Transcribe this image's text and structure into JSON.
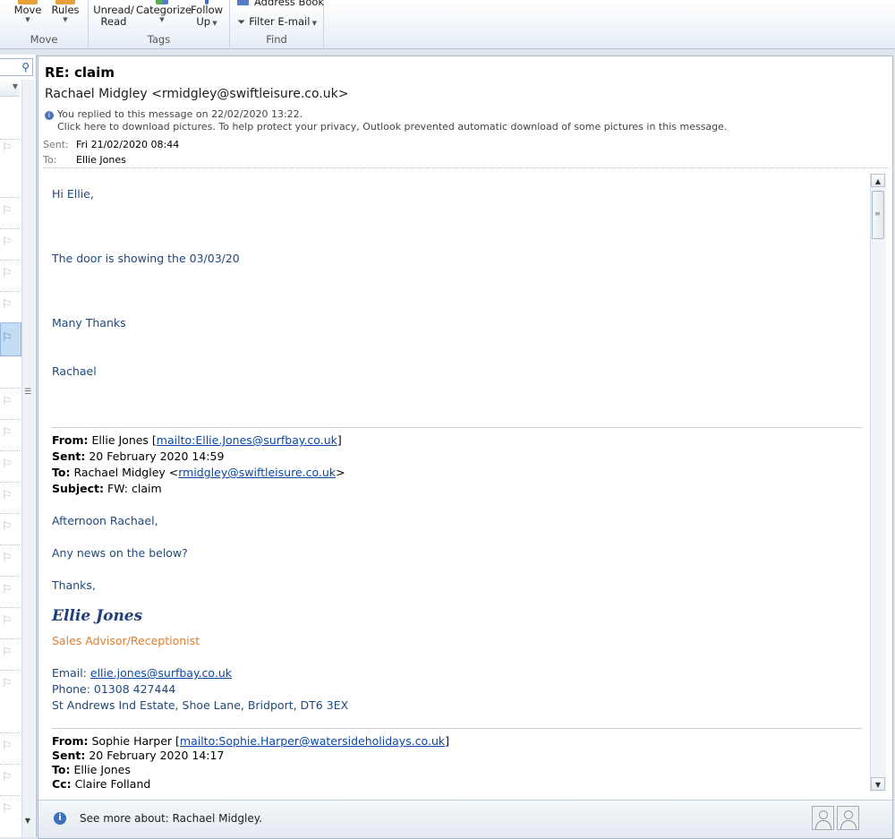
{
  "ribbon": {
    "move_group": {
      "label": "Move",
      "move": "Move",
      "rules": "Rules"
    },
    "tags_group": {
      "label": "Tags",
      "unread_line1": "Unread/",
      "unread_line2": "Read",
      "categorize": "Categorize",
      "followup_line1": "Follow",
      "followup_line2": "Up"
    },
    "find_group": {
      "label": "Find",
      "address_book": "Address Book",
      "filter_email": "Filter E-mail"
    }
  },
  "message": {
    "subject": "RE: claim",
    "sender": "Rachael Midgley <rmidgley@swiftleisure.co.uk>",
    "info_replied": "You replied to this message on 22/02/2020 13:22.",
    "info_pictures": "Click here to download pictures. To help protect your privacy, Outlook prevented automatic download of some pictures in this message.",
    "sent_label": "Sent:",
    "sent_value": "Fri 21/02/2020 08:44",
    "to_label": "To:",
    "to_value": "Ellie Jones"
  },
  "body": {
    "greeting": "Hi Ellie,",
    "line1": "The door is showing the 03/03/20",
    "thanks": "Many Thanks",
    "signoff": "Rachael",
    "quote1": {
      "from_label": "From:",
      "from_name": "Ellie Jones [",
      "from_link": "mailto:Ellie.Jones@surfbay.co.uk",
      "from_close": "]",
      "sent_label": "Sent:",
      "sent_value": "20 February 2020 14:59",
      "to_label": "To:",
      "to_name": "Rachael Midgley <",
      "to_link": "rmidgley@swiftleisure.co.uk",
      "to_close": ">",
      "subject_label": "Subject:",
      "subject_value": "FW: claim",
      "greeting": "Afternoon Rachael,",
      "line1": "Any news on the below?",
      "thanks": "Thanks,",
      "signature_name": "Ellie Jones",
      "signature_title": "Sales Advisor/Receptionist",
      "email_label": "Email: ",
      "email_link": "ellie.jones@surfbay.co.uk",
      "phone": "Phone: 01308 427444",
      "address": "St Andrews Ind Estate, Shoe Lane, Bridport, DT6 3EX"
    },
    "quote2": {
      "from_label": "From:",
      "from_name": "Sophie Harper [",
      "from_link": "mailto:Sophie.Harper@watersideholidays.co.uk",
      "from_close": "]",
      "sent_label": "Sent:",
      "sent_value": "20 February 2020 14:17",
      "to_label": "To:",
      "to_value": "Ellie Jones",
      "cc_label": "Cc:",
      "cc_value": "Claire Folland"
    }
  },
  "people_pane": {
    "text": "See more about: Rachael Midgley."
  },
  "icons": [
    "search-icon",
    "flag-icon",
    "info-icon",
    "scroll-up-icon",
    "scroll-down-icon",
    "filter-icon",
    "contact-avatar-icon"
  ],
  "colors": {
    "body_text": "#1f497d",
    "link": "#0b48a6",
    "signature_title": "#e07e2e",
    "selected_row": "#c5dcf5"
  }
}
